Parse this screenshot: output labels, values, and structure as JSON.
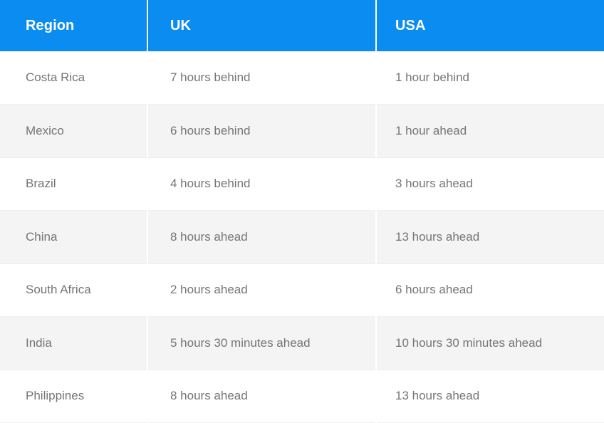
{
  "table": {
    "columns": [
      {
        "key": "region",
        "label": "Region"
      },
      {
        "key": "uk",
        "label": "UK"
      },
      {
        "key": "usa",
        "label": "USA"
      }
    ],
    "rows": [
      {
        "region": "Costa Rica",
        "uk": "7 hours behind",
        "usa": "1 hour behind"
      },
      {
        "region": "Mexico",
        "uk": "6 hours behind",
        "usa": "1 hour ahead"
      },
      {
        "region": "Brazil",
        "uk": "4 hours behind",
        "usa": "3 hours ahead"
      },
      {
        "region": "China",
        "uk": "8 hours ahead",
        "usa": "13 hours ahead"
      },
      {
        "region": "South Africa",
        "uk": "2 hours ahead",
        "usa": "6 hours ahead"
      },
      {
        "region": "India",
        "uk": "5 hours 30 minutes ahead",
        "usa": "10 hours 30 minutes ahead"
      },
      {
        "region": "Philippines",
        "uk": "8 hours ahead",
        "usa": "13 hours ahead"
      }
    ]
  },
  "colors": {
    "header_background": "#0b8cf0",
    "header_text": "#ffffff",
    "body_text": "#757575",
    "row_background": "#ffffff",
    "row_alt_background": "#f4f4f4",
    "divider": "#ffffff"
  }
}
